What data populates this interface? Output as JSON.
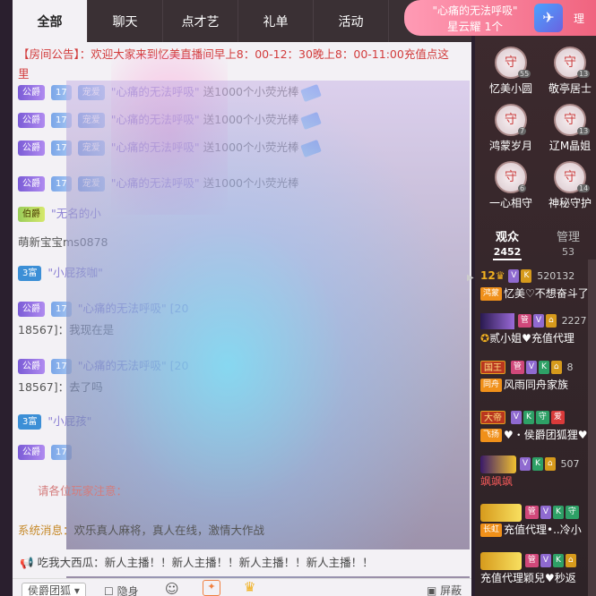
{
  "tabs": [
    "全部",
    "聊天",
    "点才艺",
    "礼单",
    "活动"
  ],
  "notice": "【房间公告】：欢迎大家来到忆美直播间早上8：00-12：30晚上8：00-11:00充值点这里",
  "gift_lines": [
    {
      "badge": "公爵",
      "level": "17",
      "tag": "宠爱",
      "sender": "\"心痛的无法呼吸\"",
      "text": "送1000个小荧光棒"
    },
    {
      "badge": "公爵",
      "level": "17",
      "tag": "宠爱",
      "sender": "\"心痛的无法呼吸\"",
      "text": "送1000个小荧光棒"
    },
    {
      "badge": "公爵",
      "level": "17",
      "tag": "宠爱",
      "sender": "\"心痛的无法呼吸\"",
      "text": "送1000个小荧光棒"
    },
    {
      "badge": "公爵",
      "level": "17",
      "tag": "宠爱",
      "sender": "\"心痛的无法呼吸\"",
      "text": "送1000个小荧光棒"
    }
  ],
  "other_lines": {
    "bo": {
      "badge": "伯爵",
      "text": "\"无名的小"
    },
    "meng": "萌新宝宝ms0878",
    "fu1": {
      "badge": "3富",
      "text": "\"小屁孩咖\""
    },
    "gong5": {
      "badge": "公爵",
      "level": "17",
      "text": "\"心痛的无法呼吸\" [20"
    },
    "line5b": "18567]：我现在是",
    "gong6": {
      "badge": "公爵",
      "level": "17",
      "text": "\"心痛的无法呼吸\" [20"
    },
    "line6b": "18567]：去了吗",
    "fu2": {
      "badge": "3富",
      "text": "\"小屁孩\""
    },
    "gong7": {
      "badge": "公爵",
      "level": "17",
      "text": ""
    }
  },
  "hint": "请各位玩家注意：",
  "system_label": "系统消息：",
  "system_text": "欢乐真人麻将，真人在线，激情大作战",
  "broadcast": "吃我大西瓜：新人主播！！新人主播！！新人主播！！新人主播！！",
  "bottom": {
    "fan_group": "侯爵团狐",
    "hide": "隐身",
    "block": "屏蔽"
  },
  "banner": {
    "line1": "\"心痛的无法呼吸\"",
    "line2": "星云耀 1个"
  },
  "guards": [
    {
      "name": "忆美小圆",
      "level": "55"
    },
    {
      "name": "敬亭居士",
      "level": "13"
    },
    {
      "name": "鸿蒙岁月",
      "level": "7"
    },
    {
      "name": "辽M晶姐",
      "level": "13"
    },
    {
      "name": "一心相守",
      "level": "6"
    },
    {
      "name": "神秘守护",
      "level": "14"
    }
  ],
  "right_tabs": {
    "audience": "观众",
    "audience_count": "2452",
    "manage": "管理",
    "manage_count": "53"
  },
  "viewers": [
    {
      "level": "12",
      "num": "520132",
      "title": "鸿蒙",
      "name": "忆美♡不想奋斗了"
    },
    {
      "level": "",
      "num": "2227",
      "title": "",
      "name": "贰小姐♥充值代理"
    },
    {
      "level": "",
      "num": "8",
      "title": "国王",
      "title2": "同舟",
      "name": "风雨同舟家族"
    },
    {
      "level": "",
      "num": "",
      "title": "大帝",
      "title2": "飞扬",
      "name": "♥・侯爵团狐狸♥・/"
    },
    {
      "level": "",
      "num": "507",
      "title": "",
      "name": "飒飒飒"
    },
    {
      "level": "",
      "num": "",
      "title": "",
      "title2": "长虹",
      "name": "充值代理•..冷小"
    },
    {
      "level": "",
      "num": "",
      "title": "",
      "name": "充值代理颖兒♥秒返"
    }
  ],
  "colors": {
    "accent": "#f0647f",
    "panel": "#3d2a2e",
    "notice": "#d23b3b"
  }
}
